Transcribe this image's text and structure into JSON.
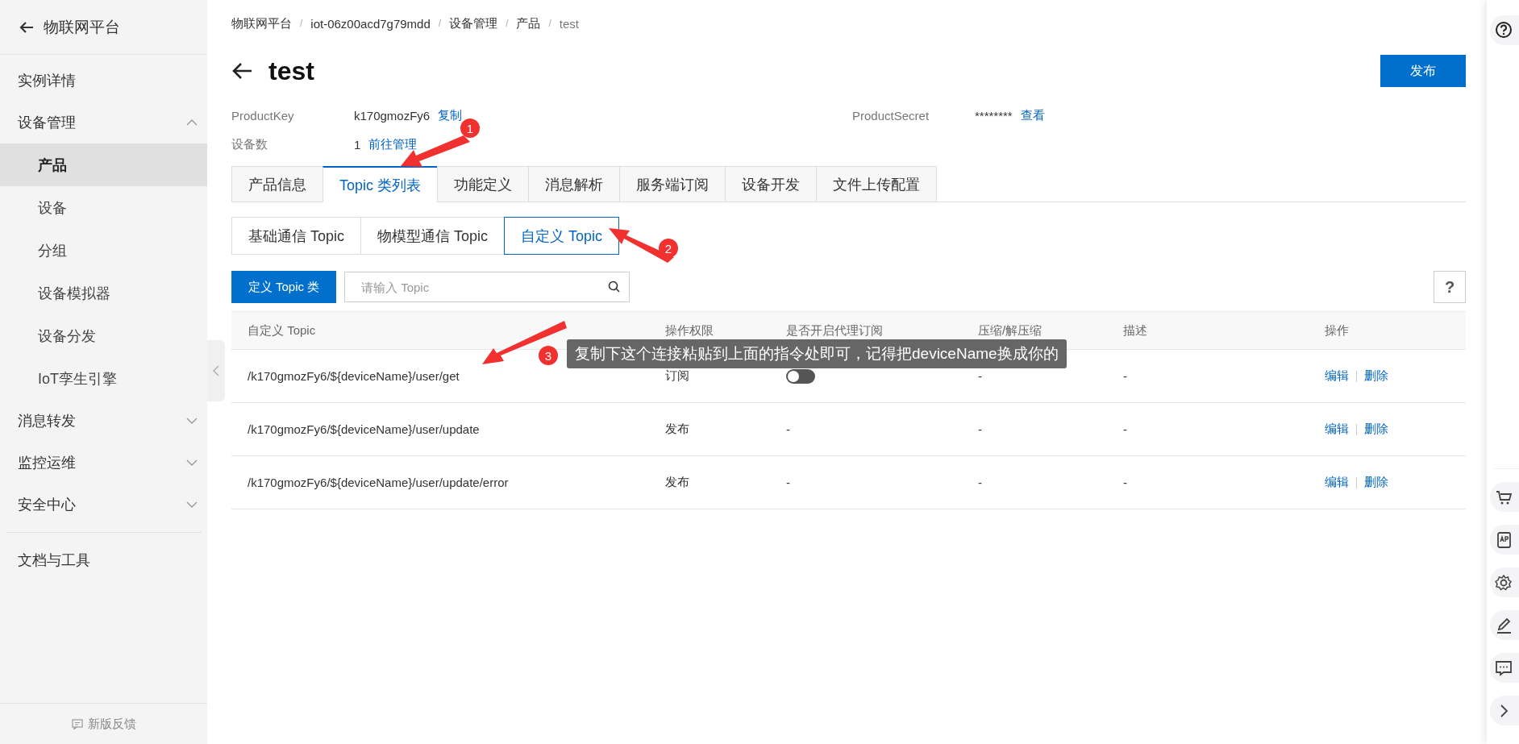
{
  "sidebar": {
    "back_title": "物联网平台",
    "items": [
      {
        "label": "实例详情"
      },
      {
        "label": "设备管理",
        "expanded": true,
        "children": [
          {
            "label": "产品",
            "selected": true
          },
          {
            "label": "设备",
            "selected": false
          },
          {
            "label": "分组",
            "selected": false
          },
          {
            "label": "设备模拟器",
            "selected": false
          },
          {
            "label": "设备分发",
            "selected": false
          },
          {
            "label": "IoT孪生引擎",
            "selected": false
          }
        ]
      },
      {
        "label": "消息转发",
        "expanded": false
      },
      {
        "label": "监控运维",
        "expanded": false
      },
      {
        "label": "安全中心",
        "expanded": false
      }
    ],
    "footer_items": [
      {
        "label": "文档与工具"
      }
    ],
    "feedback": "新版反馈"
  },
  "breadcrumb": {
    "separator": "/",
    "items": [
      "物联网平台",
      "iot-06z00acd7g79mdd",
      "设备管理",
      "产品",
      "test"
    ]
  },
  "page_title": "test",
  "publish_button": "发布",
  "info": [
    {
      "label": "ProductKey",
      "value": "k170gmozFy6",
      "link": "复制"
    },
    {
      "label": "ProductSecret",
      "value": "********",
      "link": "查看"
    },
    {
      "label": "设备数",
      "value": "1",
      "link": "前往管理"
    }
  ],
  "tabs": [
    {
      "label": "产品信息",
      "selected": false
    },
    {
      "label": "Topic 类列表",
      "selected": true
    },
    {
      "label": "功能定义",
      "selected": false
    },
    {
      "label": "消息解析",
      "selected": false
    },
    {
      "label": "服务端订阅",
      "selected": false
    },
    {
      "label": "设备开发",
      "selected": false
    },
    {
      "label": "文件上传配置",
      "selected": false
    }
  ],
  "subtabs": [
    {
      "label": "基础通信 Topic",
      "selected": false
    },
    {
      "label": "物模型通信 Topic",
      "selected": false
    },
    {
      "label": "自定义 Topic",
      "selected": true
    }
  ],
  "define_button": "定义 Topic 类",
  "search": {
    "placeholder": "请输入 Topic"
  },
  "help_button": "?",
  "table": {
    "columns": [
      "自定义 Topic",
      "操作权限",
      "是否开启代理订阅",
      "压缩/解压缩",
      "描述",
      "操作"
    ],
    "rows": [
      {
        "topic": "/k170gmozFy6/${deviceName}/user/get",
        "permission": "订阅",
        "proxy": {
          "kind": "toggle",
          "on": false
        },
        "compress": "-",
        "description": "-",
        "actions": [
          "编辑",
          "删除"
        ]
      },
      {
        "topic": "/k170gmozFy6/${deviceName}/user/update",
        "permission": "发布",
        "proxy": {
          "kind": "text",
          "text": "-"
        },
        "compress": "-",
        "description": "-",
        "actions": [
          "编辑",
          "删除"
        ]
      },
      {
        "topic": "/k170gmozFy6/${deviceName}/user/update/error",
        "permission": "发布",
        "proxy": {
          "kind": "text",
          "text": "-"
        },
        "compress": "-",
        "description": "-",
        "actions": [
          "编辑",
          "删除"
        ]
      }
    ]
  },
  "annotations": [
    {
      "number": "1"
    },
    {
      "number": "2"
    },
    {
      "number": "3",
      "note": "复制下这个连接粘贴到上面的指令处即可，记得把deviceName换成你的"
    }
  ]
}
